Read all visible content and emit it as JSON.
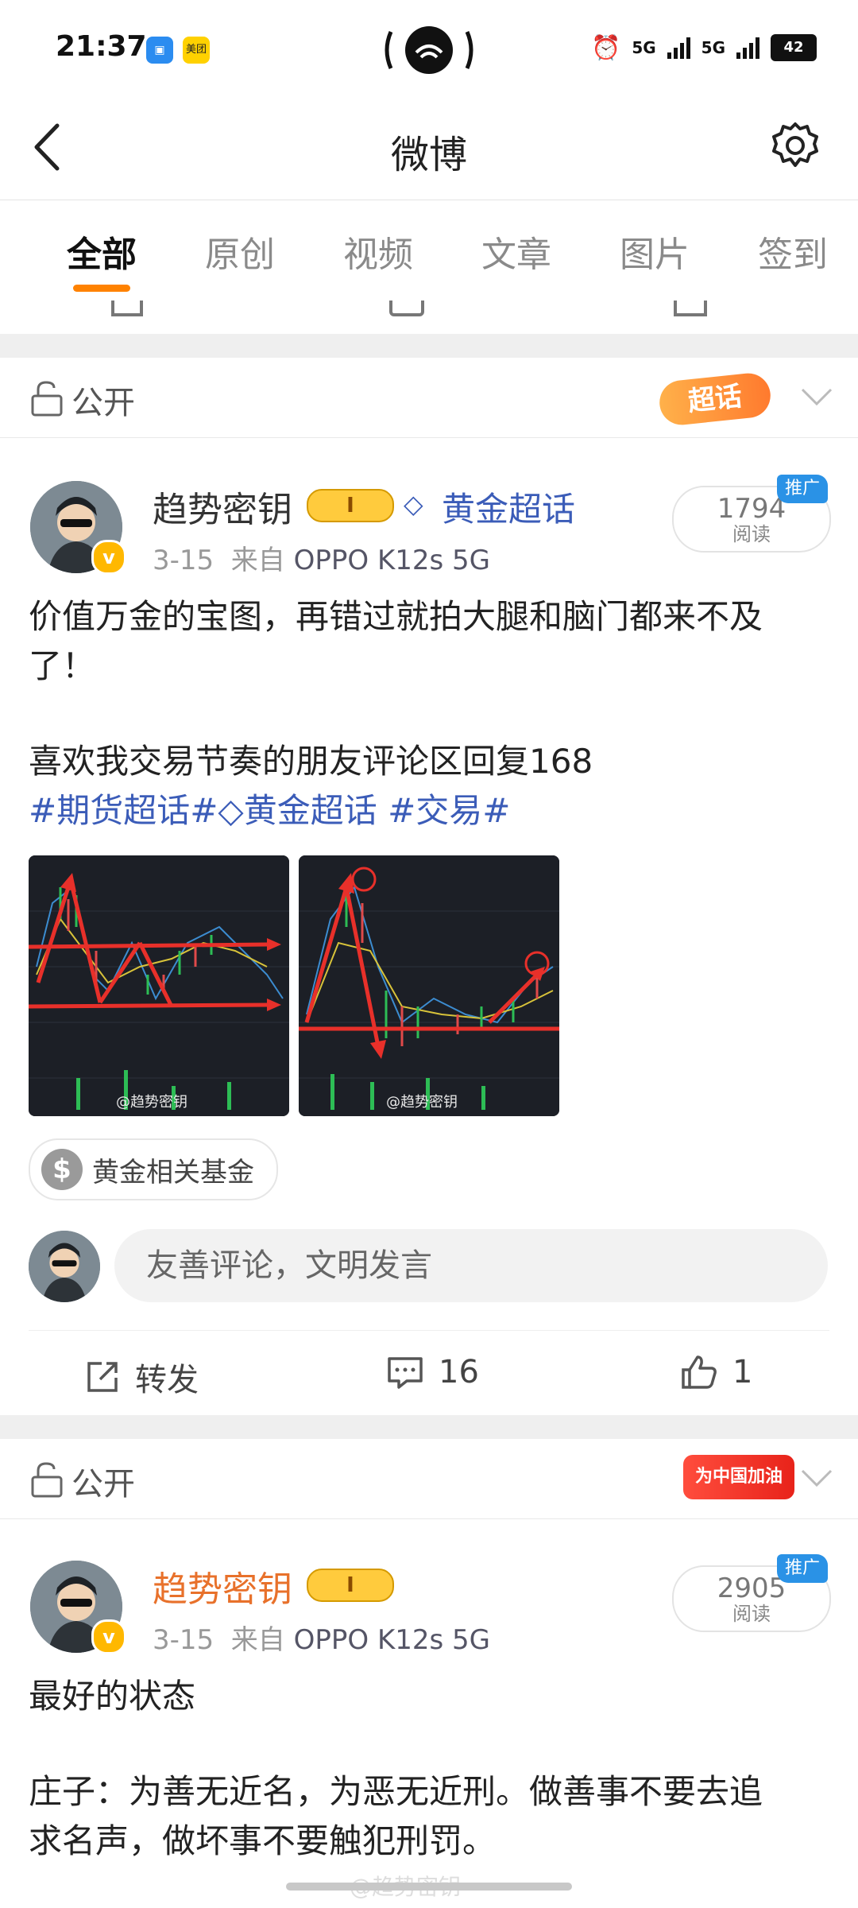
{
  "status_bar": {
    "time": "21:37",
    "apps": [
      "美团"
    ],
    "network_1": "5G",
    "network_2": "5G",
    "battery": "42"
  },
  "nav": {
    "title": "微博"
  },
  "tabs": [
    "全部",
    "原创",
    "视频",
    "文章",
    "图片",
    "签到"
  ],
  "posts": [
    {
      "visibility": "公开",
      "badge_text": "超话",
      "author": "趋势密钥",
      "level": "I",
      "topic_label": "黄金超话",
      "date": "3-15",
      "source_prefix": "来自",
      "device": "OPPO K12s 5G",
      "reads": "1794",
      "reads_label": "阅读",
      "promo": "推广",
      "text_line1": "价值万金的宝图，再错过就拍大腿和脑门都来不及",
      "text_line2": "了！",
      "text_line3": "喜欢我交易节奏的朋友评论区回复168",
      "tags": {
        "tag1": "#期货超话#",
        "tag2": "黄金超话",
        "tag3": "#交易#"
      },
      "image_watermark": "@趋势密钥",
      "fund_chip": "黄金相关基金",
      "comment_placeholder": "友善评论，文明发言",
      "repost_label": "转发",
      "comments": "16",
      "likes": "1"
    },
    {
      "visibility": "公开",
      "badge_text": "为中国加油",
      "author": "趋势密钥",
      "level": "I",
      "date": "3-15",
      "source_prefix": "来自",
      "device": "OPPO K12s 5G",
      "reads": "2905",
      "reads_label": "阅读",
      "promo": "推广",
      "text_line1": "最好的状态",
      "text_line2": "庄子：为善无近名，为恶无近刑。做善事不要去追",
      "text_line3": "求名声，做坏事不要触犯刑罚。"
    }
  ],
  "watermark": "@趋势密钥",
  "colors": {
    "accent": "#ff8200",
    "link": "#3b5cb8",
    "promo": "#2a92e6",
    "chart_bg": "#1c1f26",
    "arrow": "#e8302a"
  }
}
